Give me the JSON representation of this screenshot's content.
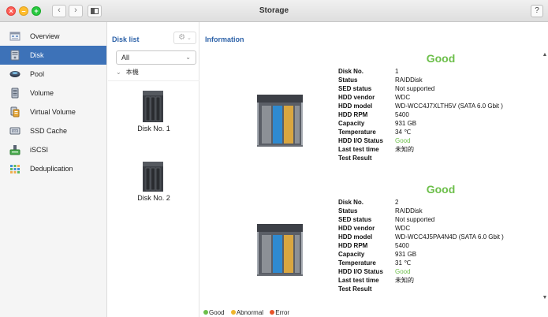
{
  "window": {
    "title": "Storage",
    "help_label": "?",
    "back_glyph": "‹",
    "forward_glyph": "›"
  },
  "sidebar": {
    "items": [
      {
        "label": "Overview",
        "icon": "overview-icon"
      },
      {
        "label": "Disk",
        "icon": "disk-icon",
        "active": true
      },
      {
        "label": "Pool",
        "icon": "pool-icon"
      },
      {
        "label": "Volume",
        "icon": "volume-icon"
      },
      {
        "label": "Virtual Volume",
        "icon": "virtual-volume-icon"
      },
      {
        "label": "SSD Cache",
        "icon": "ssd-cache-icon"
      },
      {
        "label": "iSCSI",
        "icon": "iscsi-icon"
      },
      {
        "label": "Deduplication",
        "icon": "deduplication-icon"
      }
    ]
  },
  "disk_list": {
    "title": "Disk list",
    "filter_value": "All",
    "tree_node": "本機",
    "disks": [
      {
        "label": "Disk No. 1"
      },
      {
        "label": "Disk No. 2"
      }
    ]
  },
  "info": {
    "title": "Information",
    "field_labels": [
      "Disk No.",
      "Status",
      "SED status",
      "HDD vendor",
      "HDD model",
      "HDD RPM",
      "Capacity",
      "Temperature",
      "HDD I/O Status",
      "Last test time",
      "Test Result"
    ],
    "disks": [
      {
        "health": "Good",
        "values": [
          "1",
          "RAIDDisk",
          "Not supported",
          "WDC",
          "WD-WCC4J7XLTH5V (SATA 6.0 Gbit )",
          "5400",
          "931 GB",
          "34 ℃",
          "Good",
          "未知的",
          ""
        ]
      },
      {
        "health": "Good",
        "values": [
          "2",
          "RAIDDisk",
          "Not supported",
          "WDC",
          "WD-WCC4J5PA4N4D (SATA 6.0 Gbit )",
          "5400",
          "931 GB",
          "31 ℃",
          "Good",
          "未知的",
          ""
        ]
      }
    ]
  },
  "legend": [
    {
      "label": "Good",
      "color": "#6cbf4a"
    },
    {
      "label": "Abnormal",
      "color": "#f0b52c"
    },
    {
      "label": "Error",
      "color": "#e8542a"
    }
  ],
  "colors": {
    "accent": "#3d72b8",
    "good": "#6cbf4a"
  }
}
